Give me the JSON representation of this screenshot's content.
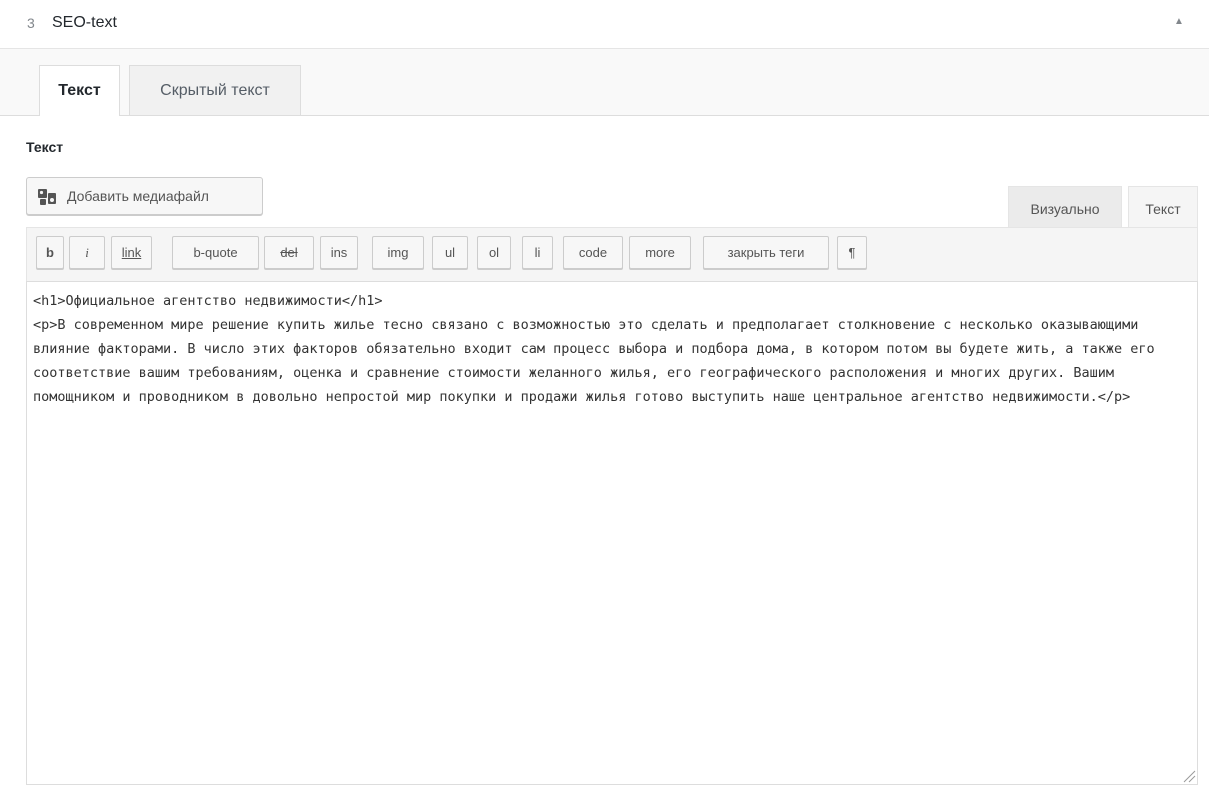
{
  "panel": {
    "number": "3",
    "title": "SEO-text",
    "toggle_icon": "triangle-up-icon"
  },
  "tabs": [
    {
      "label": "Текст",
      "active": true
    },
    {
      "label": "Скрытый текст",
      "active": false
    }
  ],
  "field": {
    "label": "Текст"
  },
  "media_button": {
    "icon": "media-icon",
    "label": "Добавить медиафайл"
  },
  "editor_modes": [
    {
      "label": "Визуально",
      "active": false
    },
    {
      "label": "Текст",
      "active": true
    }
  ],
  "toolbar": {
    "buttons": [
      "b",
      "i",
      "link",
      "b-quote",
      "del",
      "ins",
      "img",
      "ul",
      "ol",
      "li",
      "code",
      "more",
      "закрыть теги",
      "¶"
    ]
  },
  "editor": {
    "content": "<h1>Официальное агентство недвижимости</h1>\n<p>В современном мире решение купить жилье тесно связано с возможностью это сделать и предполагает столкновение с несколько оказывающими влияние факторами. В число этих факторов обязательно входит сам процесс выбора и подбора дома, в котором потом вы будете жить, а также его соответствие вашим требованиям, оценка и сравнение стоимости желанного жилья, его географического расположения и многих других. Вашим помощником и проводником в довольно непростой мир покупки и продажи жилья готово выступить наше центральное агентство недвижимости.</p>"
  },
  "colors": {
    "border": "#dddddd",
    "toolbar_bg": "#f5f5f5",
    "text": "#23282d"
  }
}
